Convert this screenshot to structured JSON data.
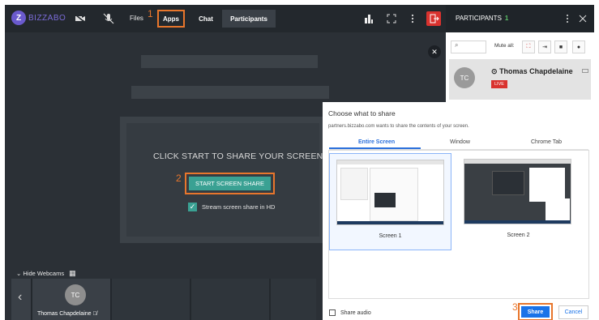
{
  "app": {
    "logo_letter": "Z",
    "logo_text": "BIZZABO"
  },
  "topbar": {
    "files_label": "Files",
    "apps_label": "Apps",
    "chat_label": "Chat",
    "participants_tab_label": "Participants",
    "callout_1": "1"
  },
  "participants_panel": {
    "title": "PARTICIPANTS",
    "count": "1",
    "mute_all_label": "Mute all:",
    "participant": {
      "initials": "TC",
      "name": "Thomas Chapdelaine",
      "badge": "LIVE"
    }
  },
  "stage": {
    "headline": "CLICK START TO SHARE YOUR SCREEN",
    "start_button": "START SCREEN SHARE",
    "hd_label": "Stream screen share in HD",
    "callout_2": "2"
  },
  "webcams": {
    "toggle_label": "Hide Webcams",
    "tile": {
      "initials": "TC",
      "name": "Thomas Chapdelaine"
    }
  },
  "dialog": {
    "title": "Choose what to share",
    "subtitle": "partners.bizzabo.com wants to share the contents of your screen.",
    "tabs": [
      "Entire Screen",
      "Window",
      "Chrome Tab"
    ],
    "active_tab": "Entire Screen",
    "screens": [
      "Screen 1",
      "Screen 2"
    ],
    "share_audio_label": "Share audio",
    "share_button": "Share",
    "cancel_button": "Cancel",
    "callout_3": "3"
  },
  "colors": {
    "accent_orange": "#e8762c",
    "teal": "#3aa193",
    "blue": "#1a73e8",
    "live_red": "#d9322e"
  }
}
